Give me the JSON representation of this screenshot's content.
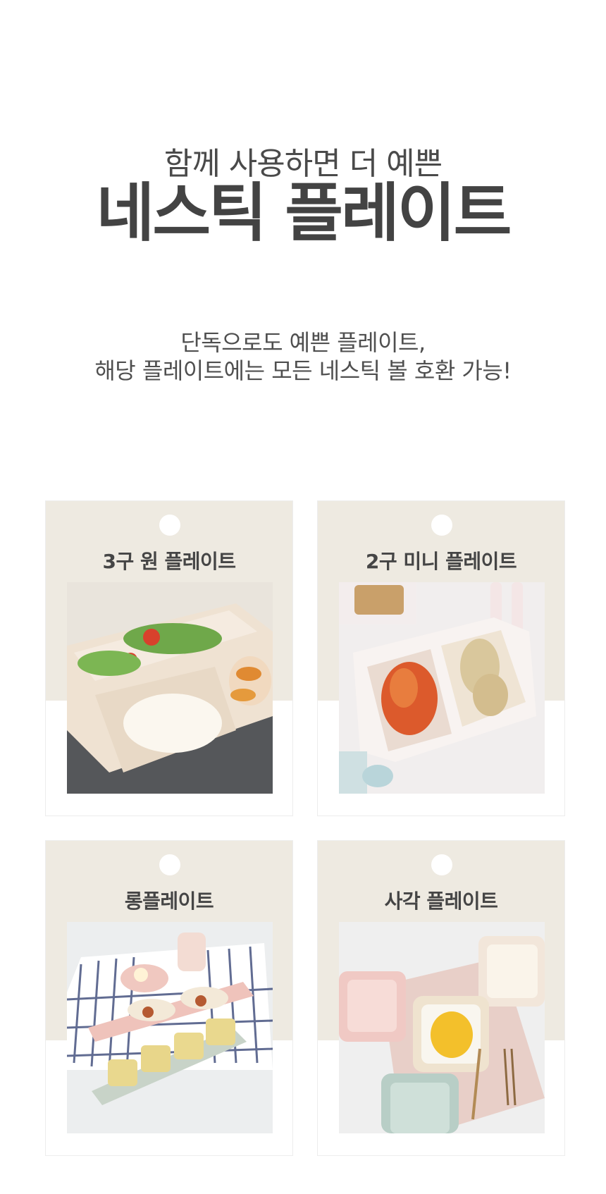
{
  "hero": {
    "subtitle": "함께 사용하면 더 예쁜",
    "title": "네스틱 플레이트"
  },
  "description": {
    "line1": "단독으로도 예쁜 플레이트,",
    "line2": "해당 플레이트에는 모든 네스틱 볼 호환 가능!"
  },
  "products": [
    {
      "label": "3구 원 플레이트",
      "photo": "three-compartment-plate-photo"
    },
    {
      "label": "2구 미니 플레이트",
      "photo": "two-compartment-mini-plate-photo"
    },
    {
      "label": "롱플레이트",
      "photo": "long-plate-photo"
    },
    {
      "label": "사각 플레이트",
      "photo": "square-plate-photo"
    }
  ],
  "colors": {
    "card_top": "#eeeae1",
    "text": "#434343",
    "background": "#ffffff"
  }
}
